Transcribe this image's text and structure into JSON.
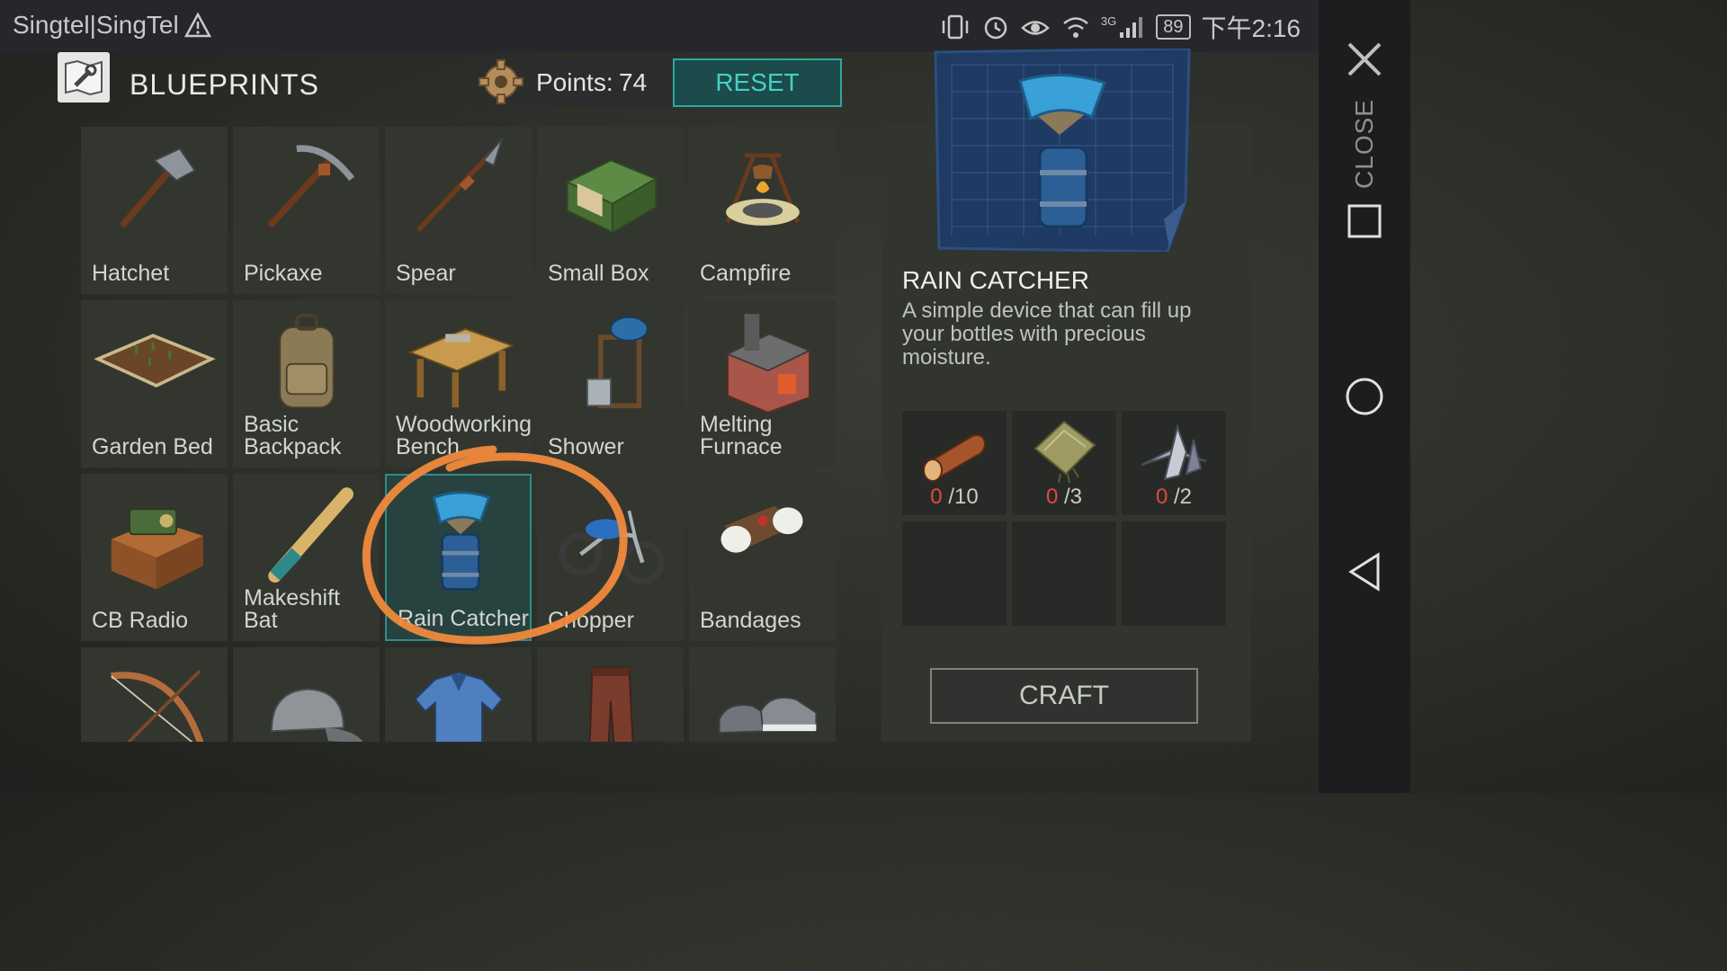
{
  "status_bar": {
    "carrier": "Singtel|SingTel",
    "network": "3G",
    "battery": "89",
    "time": "下午2:16"
  },
  "nav": {
    "close_label": "CLOSE"
  },
  "header": {
    "title": "BLUEPRINTS",
    "points_label": "Points:",
    "points_value": "74",
    "reset_label": "RESET"
  },
  "grid": {
    "items": [
      {
        "label": "Hatchet",
        "icon": "hatchet-icon"
      },
      {
        "label": "Pickaxe",
        "icon": "pickaxe-icon"
      },
      {
        "label": "Spear",
        "icon": "spear-icon"
      },
      {
        "label": "Small Box",
        "icon": "small-box-icon"
      },
      {
        "label": "Campfire",
        "icon": "campfire-icon"
      },
      {
        "label": "Garden Bed",
        "icon": "garden-bed-icon"
      },
      {
        "label": "Basic\nBackpack",
        "icon": "backpack-icon"
      },
      {
        "label": "Woodworking\nBench",
        "icon": "workbench-icon"
      },
      {
        "label": "Shower",
        "icon": "shower-icon"
      },
      {
        "label": "Melting\nFurnace",
        "icon": "furnace-icon"
      },
      {
        "label": "CB Radio",
        "icon": "radio-icon"
      },
      {
        "label": "Makeshift\nBat",
        "icon": "bat-icon"
      },
      {
        "label": "Rain Catcher",
        "icon": "rain-catcher-icon",
        "selected": true
      },
      {
        "label": "Chopper",
        "icon": "motorcycle-icon"
      },
      {
        "label": "Bandages",
        "icon": "bandages-icon"
      },
      {
        "label": "",
        "icon": "bow-icon"
      },
      {
        "label": "",
        "icon": "cap-icon"
      },
      {
        "label": "",
        "icon": "shirt-icon"
      },
      {
        "label": "",
        "icon": "pants-icon"
      },
      {
        "label": "",
        "icon": "sneakers-icon"
      }
    ]
  },
  "detail": {
    "title": "RAIN CATCHER",
    "description": "A simple device that can fill up your bottles with precious moisture.",
    "resources": [
      {
        "icon": "log-icon",
        "have": "0",
        "need": "/10"
      },
      {
        "icon": "cloth-icon",
        "have": "0",
        "need": "/3"
      },
      {
        "icon": "metal-scrap-icon",
        "have": "0",
        "need": "/2"
      }
    ],
    "craft_label": "CRAFT"
  },
  "colors": {
    "accent": "#2fa89f",
    "required_zero": "#e04a3e",
    "annotation": "#f08a3c"
  }
}
